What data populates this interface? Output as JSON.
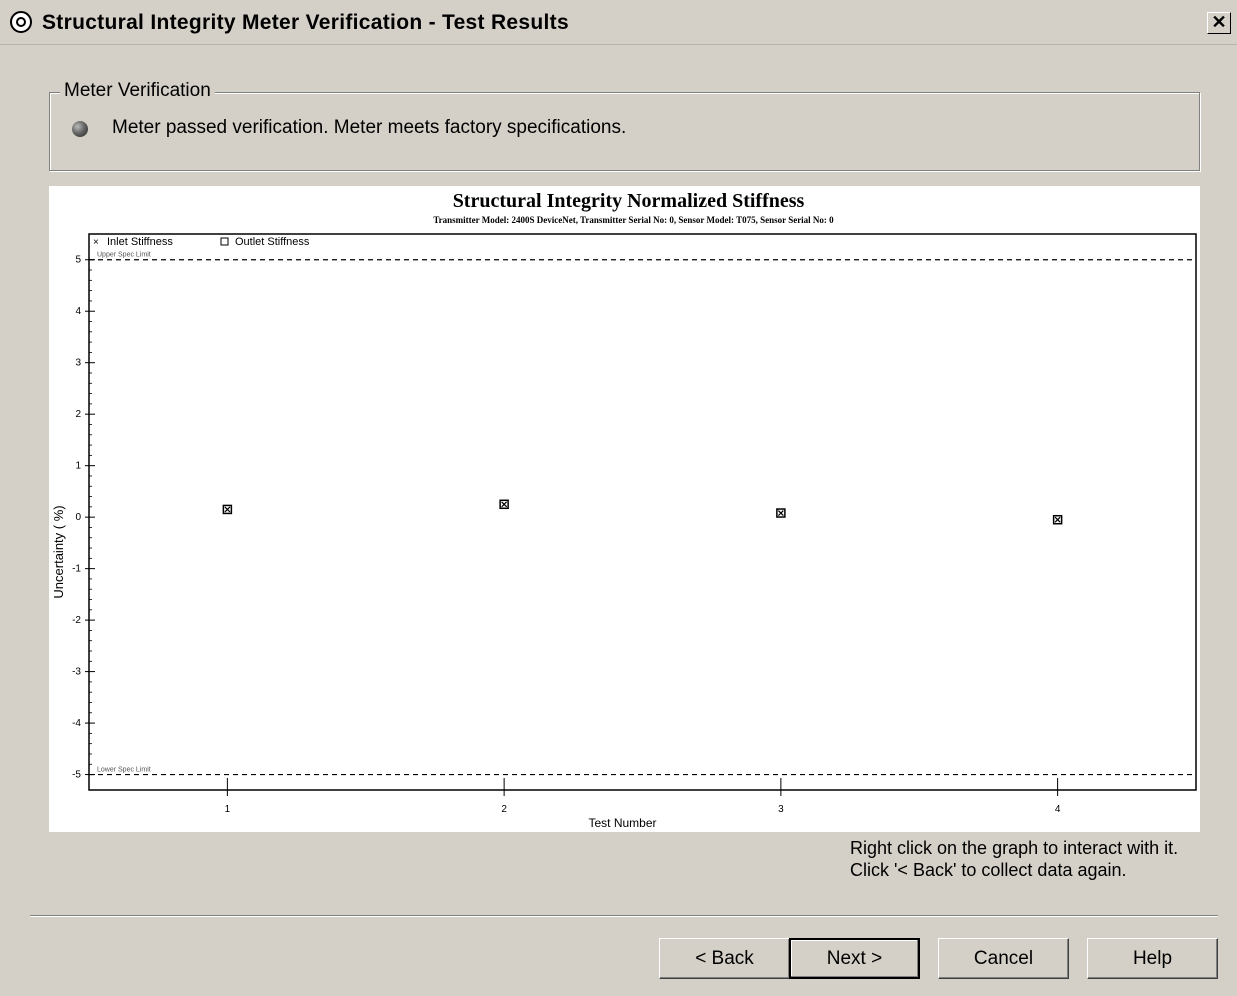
{
  "window": {
    "title": "Structural Integrity Meter Verification - Test Results",
    "close_glyph": "✕"
  },
  "verification": {
    "group_label": "Meter Verification",
    "status_icon": "gray-sphere-icon",
    "status_text": "Meter passed verification. Meter meets factory specifications."
  },
  "chart_data": {
    "type": "scatter",
    "title": "Structural Integrity Normalized Stiffness",
    "subtitle": "Transmitter Model: 2400S DeviceNet, Transmitter Serial No: 0, Sensor Model: T075, Sensor Serial No: 0",
    "xlabel": "Test Number",
    "ylabel": "Uncertainty ( %)",
    "xlim": [
      0.5,
      4.5
    ],
    "ylim": [
      -5.3,
      5.5
    ],
    "xticks": [
      1,
      2,
      3,
      4
    ],
    "yticks": [
      5,
      4,
      3,
      2,
      1,
      0,
      -1,
      -2,
      -3,
      -4,
      -5
    ],
    "legend": [
      "Inlet Stiffness",
      "Outlet Stiffness"
    ],
    "legend_placement": "top-left",
    "series": [
      {
        "name": "Inlet Stiffness",
        "marker": "x",
        "x": [
          1,
          2,
          3,
          4
        ],
        "y": [
          0.15,
          0.25,
          0.08,
          -0.05
        ]
      },
      {
        "name": "Outlet Stiffness",
        "marker": "square",
        "x": [
          1,
          2,
          3,
          4
        ],
        "y": [
          0.15,
          0.25,
          0.08,
          -0.05
        ]
      }
    ],
    "limits": [
      {
        "label": "Upper Spec Limit",
        "y": 5
      },
      {
        "label": "Lower Spec Limit",
        "y": -5
      }
    ],
    "grid": false
  },
  "help_text": {
    "line1": "Right click on the graph to interact with it.",
    "line2": "Click '< Back' to collect data again."
  },
  "buttons": {
    "back": "< Back",
    "next": "Next >",
    "cancel": "Cancel",
    "help": "Help"
  }
}
